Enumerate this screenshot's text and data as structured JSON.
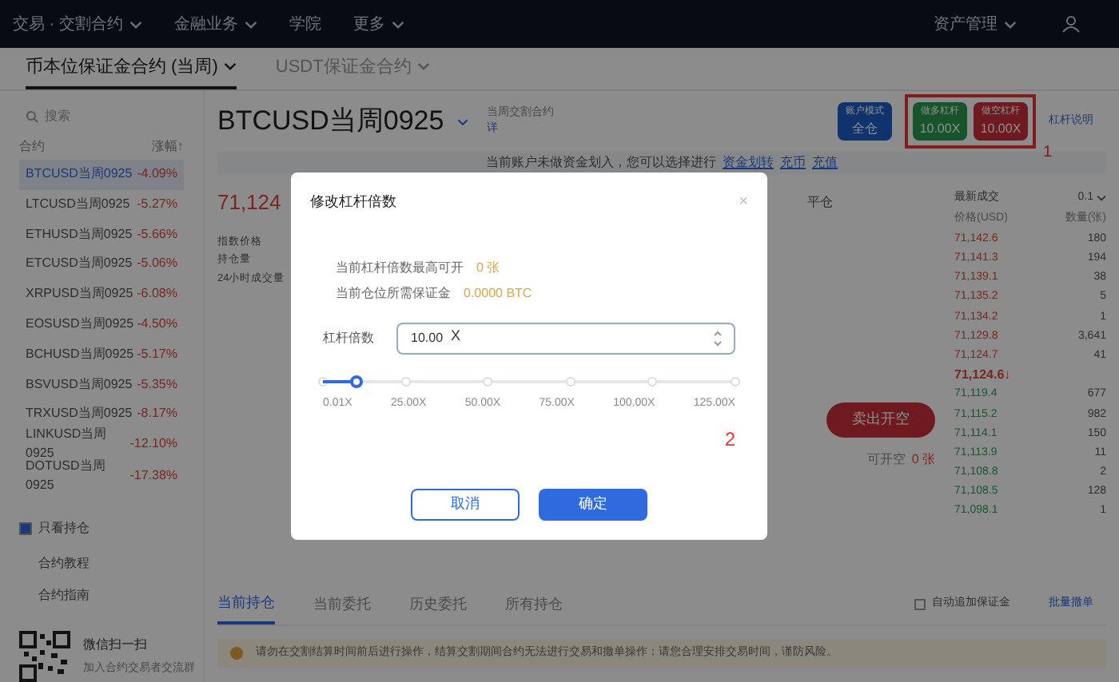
{
  "nav": {
    "items": [
      {
        "label": "交易 · 交割合约",
        "dropdown": true
      },
      {
        "label": "金融业务",
        "dropdown": true
      },
      {
        "label": "学院",
        "dropdown": false
      },
      {
        "label": "更多",
        "dropdown": true
      }
    ],
    "account": "资产管理"
  },
  "subnav": {
    "tabs": [
      {
        "label": "币本位保证金合约 (当周)",
        "selected": true
      },
      {
        "label": "USDT保证金合约",
        "selected": false
      }
    ]
  },
  "sidebar": {
    "search_placeholder": "搜索",
    "columns": [
      "合约",
      "涨幅↑"
    ],
    "rows": [
      {
        "name": "BTCUSD当周0925",
        "change": "-4.09%",
        "selected": true
      },
      {
        "name": "LTCUSD当周0925",
        "change": "-5.27%",
        "selected": false
      },
      {
        "name": "ETHUSD当周0925",
        "change": "-5.66%",
        "selected": false
      },
      {
        "name": "ETCUSD当周0925",
        "change": "-5.06%",
        "selected": false
      },
      {
        "name": "XRPUSD当周0925",
        "change": "-6.08%",
        "selected": false
      },
      {
        "name": "EOSUSD当周0925",
        "change": "-4.50%",
        "selected": false
      },
      {
        "name": "BCHUSD当周0925",
        "change": "-5.17%",
        "selected": false
      },
      {
        "name": "BSVUSD当周0925",
        "change": "-5.35%",
        "selected": false
      },
      {
        "name": "TRXUSD当周0925",
        "change": "-8.17%",
        "selected": false
      },
      {
        "name": "LINKUSD当周0925",
        "change": "-12.10%",
        "selected": false
      },
      {
        "name": "DOTUSD当周0925",
        "change": "-17.38%",
        "selected": false
      }
    ],
    "show_all": {
      "label": "只看持仓",
      "checked": true
    },
    "links": [
      "合约教程",
      "合约指南"
    ],
    "qr": {
      "title": "微信扫一扫",
      "subtitle": "加入合约交易者交流群"
    }
  },
  "header": {
    "contract": "BTCUSD当周0925",
    "subtitle": "当周交割合约",
    "subtitle_link": "详",
    "account_mode": {
      "label": "账户模式",
      "value": "全仓"
    },
    "long_leverage": {
      "label": "做多杠杆",
      "value": "10.00X"
    },
    "short_leverage": {
      "label": "做空杠杆",
      "value": "10.00X"
    },
    "help": "杠杆说明",
    "annotation": "1"
  },
  "notice": {
    "text": "当前账户未做资金划入，您可以选择进行",
    "links": [
      "资金划转",
      "充币",
      "充值"
    ]
  },
  "ticker": {
    "price": "71,124",
    "labels": [
      "指数价格",
      "持仓量",
      "24小时成交量"
    ]
  },
  "trade": {
    "tab": "平仓",
    "sell_button": "卖出开空",
    "available": "可开空",
    "available_value": "0 张"
  },
  "orderbook": {
    "title": "最新成交",
    "precision": "0.1",
    "columns": [
      "价格(USD)",
      "数量(张)"
    ],
    "rows": [
      {
        "kind": "ask",
        "price": "71,142.6",
        "size": "180"
      },
      {
        "kind": "ask",
        "price": "71,141.3",
        "size": "194"
      },
      {
        "kind": "ask",
        "price": "71,139.1",
        "size": "38"
      },
      {
        "kind": "ask",
        "price": "71,135.2",
        "size": "5"
      },
      {
        "kind": "ask",
        "price": "71,134.2",
        "size": "1"
      },
      {
        "kind": "ask",
        "price": "71,129.8",
        "size": "3,641"
      },
      {
        "kind": "ask",
        "price": "71,124.7",
        "size": "41"
      },
      {
        "kind": "last",
        "price": "71,124.6↓",
        "size": ""
      },
      {
        "kind": "bid",
        "price": "71,119.4",
        "size": "677"
      },
      {
        "kind": "bid",
        "price": "71,115.2",
        "size": "982"
      },
      {
        "kind": "bid",
        "price": "71,114.1",
        "size": "150"
      },
      {
        "kind": "bid",
        "price": "71,113.9",
        "size": "11"
      },
      {
        "kind": "bid",
        "price": "71,108.8",
        "size": "2"
      },
      {
        "kind": "bid",
        "price": "71,108.5",
        "size": "128"
      },
      {
        "kind": "bid",
        "price": "71,098.1",
        "size": "1"
      }
    ]
  },
  "bottom": {
    "tabs": [
      {
        "label": "当前持仓",
        "selected": true
      },
      {
        "label": "当前委托",
        "selected": false
      },
      {
        "label": "历史委托",
        "selected": false
      },
      {
        "label": "所有持仓",
        "selected": false
      }
    ],
    "auto_margin": {
      "label": "自动追加保证金",
      "checked": false
    },
    "batch": "批量撤单",
    "warning": "请勿在交割结算时间前后进行操作，结算交割期间合约无法进行交易和撤单操作；请您合理安排交易时间，谨防风险。"
  },
  "dialog": {
    "title": "修改杠杆倍数",
    "close": "×",
    "lines": [
      {
        "label": "当前杠杆倍数最高可开",
        "value": "0 张"
      },
      {
        "label": "当前仓位所需保证金",
        "value": "0.0000 BTC"
      }
    ],
    "field_label": "杠杆倍数",
    "value": "10.00",
    "unit": "X",
    "slider": {
      "level": 0.08,
      "ticks": [
        "0.01X",
        "25.00X",
        "50.00X",
        "75.00X",
        "100.00X",
        "125.00X"
      ]
    },
    "annotation": "2",
    "cancel": "取消",
    "confirm": "确定"
  }
}
